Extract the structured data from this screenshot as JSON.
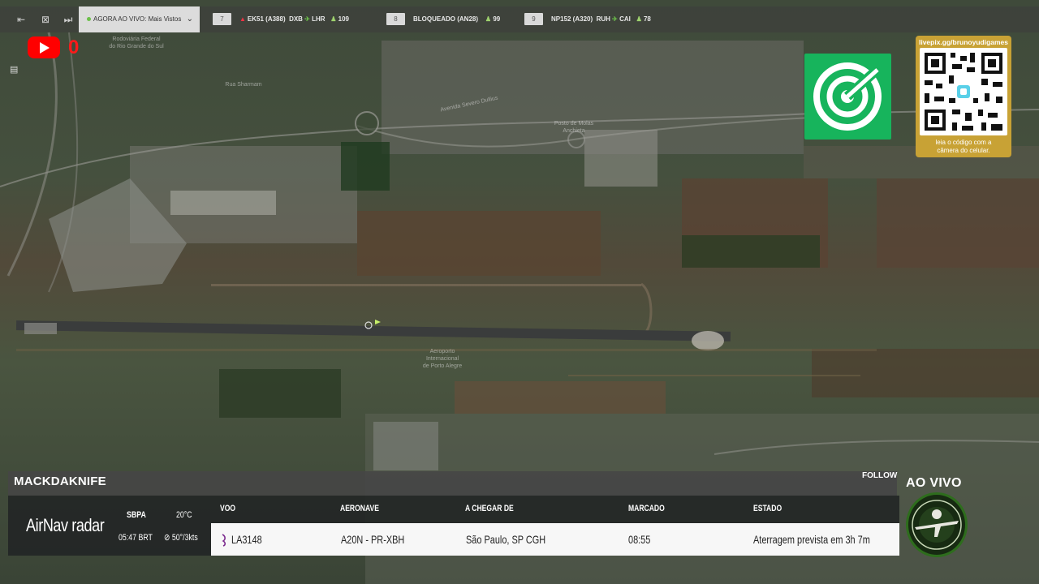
{
  "toolbar": {
    "live_label": "AGORA AO VIVO: Mais Vistos",
    "flights": [
      {
        "rank": "7",
        "callsign": "EK51 (A388)",
        "from": "DXB",
        "to": "LHR",
        "count": "109"
      },
      {
        "rank": "8",
        "callsign": "BLOQUEADO (AN28)",
        "from": "",
        "to": "",
        "count": "99"
      },
      {
        "rank": "9",
        "callsign": "NP152 (A320)",
        "from": "RUH",
        "to": "CAI",
        "count": "78"
      }
    ]
  },
  "youtube": {
    "count": "0"
  },
  "map": {
    "labels": {
      "rodoviaria": "Rodoviária Federal\ndo Rio Grande do Sul",
      "posto": "Posto de Molas\nAnchieta",
      "airport": "Aeroporto\nInternacional\nde Porto Alegre",
      "street1": "Avenida Severo Dullius",
      "street2": "Rua Sharmam"
    }
  },
  "qr": {
    "url": "livepix.gg/brunoyudigames",
    "hint": "leia o código com a\ncâmera do celular."
  },
  "panel": {
    "callsign": "MACKDAKNIFE",
    "follow": "FOLLOW",
    "brand_main": "AirNav",
    "brand_sub": "radar",
    "airport": "SBPA",
    "time": "05:47 BRT",
    "temp": "20°C",
    "wind": "50°/3kts",
    "columns": [
      "VOO",
      "AERONAVE",
      "A CHEGAR DE",
      "MARCADO",
      "ESTADO"
    ],
    "row": {
      "flight": "LA3148",
      "aircraft": "A20N - PR-XBH",
      "origin": "São Paulo, SP CGH",
      "scheduled": "08:55",
      "status": "Aterragem prevista em 3h 7m"
    },
    "ao_vivo": "AO VIVO"
  },
  "colors": {
    "fr24": "#17b45c",
    "qr_card": "#c8a235",
    "youtube": "#ff0000",
    "count_green": "#6cc04a",
    "airline_mark": "#7b2a8e"
  }
}
